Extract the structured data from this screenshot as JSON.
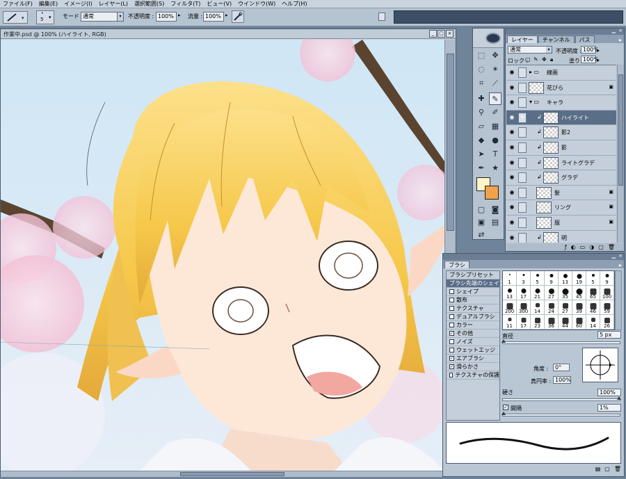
{
  "menu": [
    "ファイル(F)",
    "編集(E)",
    "イメージ(I)",
    "レイヤー(L)",
    "選択範囲(S)",
    "フィルタ(T)",
    "ビュー(V)",
    "ウインドウ(W)",
    "ヘルプ(H)"
  ],
  "options": {
    "brush_size": "5",
    "mode_label": "モード :",
    "mode_value": "通常",
    "opacity_label": "不透明度 :",
    "opacity_value": "100%",
    "flow_label": "流量 :",
    "flow_value": "100%"
  },
  "document": {
    "title": "作業中.psd @ 100% (ハイライト, RGB)"
  },
  "layers_panel": {
    "tabs": [
      "レイヤー",
      "チャンネル",
      "パス"
    ],
    "blend_mode": "通常",
    "opacity_label": "不透明度 :",
    "opacity": "100%",
    "lock_label": "ロック :",
    "fill_label": "塗り :",
    "fill": "100%",
    "layers": [
      {
        "name": "線画",
        "kind": "group",
        "visible": true
      },
      {
        "name": "花びら",
        "kind": "layer",
        "visible": true,
        "locked": true
      },
      {
        "name": "キャラ",
        "kind": "group-open",
        "visible": true
      },
      {
        "name": "ハイライト",
        "kind": "layer",
        "visible": true,
        "selected": true,
        "clipped": true
      },
      {
        "name": "影2",
        "kind": "layer",
        "visible": true,
        "clipped": true
      },
      {
        "name": "影",
        "kind": "layer",
        "visible": true,
        "clipped": true
      },
      {
        "name": "ライトグラデ",
        "kind": "layer",
        "visible": true,
        "clipped": true
      },
      {
        "name": "グラデ",
        "kind": "layer",
        "visible": true,
        "clipped": true
      },
      {
        "name": "髪",
        "kind": "layer",
        "visible": true,
        "locked": true
      },
      {
        "name": "リング",
        "kind": "layer",
        "visible": true,
        "locked": true
      },
      {
        "name": "服",
        "kind": "layer",
        "visible": true,
        "locked": true
      },
      {
        "name": "明",
        "kind": "layer",
        "visible": true,
        "clipped": true
      }
    ]
  },
  "brush_panel": {
    "title": "ブラシ",
    "items": [
      {
        "label": "ブラシプリセット",
        "check": null
      },
      {
        "label": "ブラシ先端のシェイプ",
        "check": null,
        "selected": true
      },
      {
        "label": "シェイプ",
        "check": false
      },
      {
        "label": "散布",
        "check": false
      },
      {
        "label": "テクスチャ",
        "check": false
      },
      {
        "label": "デュアルブラシ",
        "check": false
      },
      {
        "label": "カラー",
        "check": false
      },
      {
        "label": "その他",
        "check": true
      },
      {
        "label": "ノイズ",
        "check": false
      },
      {
        "label": "ウェットエッジ",
        "check": false
      },
      {
        "label": "エアブラシ",
        "check": true
      },
      {
        "label": "滑らかさ",
        "check": true
      },
      {
        "label": "テクスチャの保護",
        "check": false
      }
    ],
    "presets": [
      "1",
      "3",
      "5",
      "9",
      "13",
      "19",
      "5",
      "9",
      "13",
      "17",
      "21",
      "27",
      "35",
      "45",
      "65",
      "100",
      "200",
      "300",
      "14",
      "24",
      "27",
      "39",
      "46",
      "59",
      "11",
      "17",
      "23",
      "36",
      "44",
      "60",
      "14",
      "26"
    ],
    "diameter_label": "直径",
    "diameter": "5 px",
    "angle_label": "角度 :",
    "angle": "0°",
    "roundness_label": "真円率 :",
    "roundness": "100%",
    "hardness_label": "硬さ",
    "hardness": "100%",
    "spacing_label": "間隔",
    "spacing": "1%"
  }
}
